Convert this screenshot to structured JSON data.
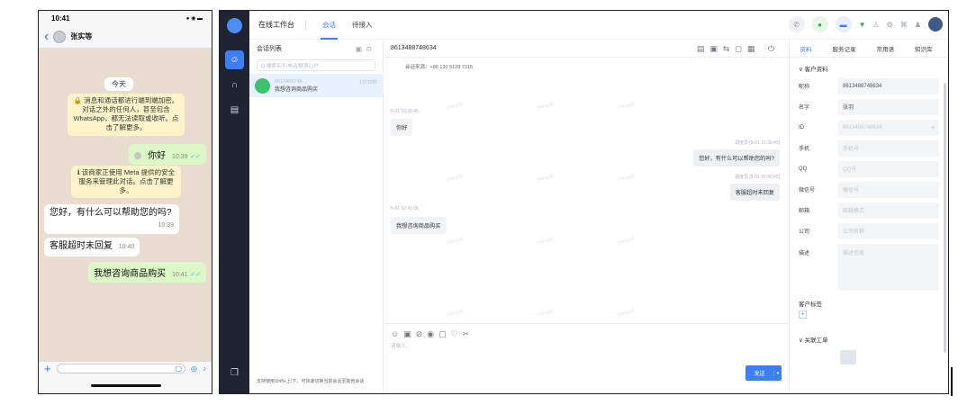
{
  "phone": {
    "status_time": "10:41",
    "status_icons": "● ◉ ▬",
    "back": "‹",
    "contact_name": "张实等",
    "day": "今天",
    "encryption_notice": "🔒 消息和通话都进行端到端加密。对话之外的任何人，甚至包含 WhatsApp，都无法读取或收听。点击了解更多。",
    "meta_notice": "ℹ 该商家正使用 Meta 提供的安全服务来管理此对话。点击了解更多。",
    "messages": [
      {
        "text": "你好",
        "time": "10:39"
      },
      {
        "text": "您好，有什么可以帮助您的吗?",
        "time": "10:39"
      },
      {
        "text": "客服超时未回复",
        "time": "10:40"
      },
      {
        "text": "我想咨询商品购买",
        "time": "10:41"
      }
    ]
  },
  "app": {
    "title": "在线工作台",
    "tabs": [
      "会话",
      "待接入"
    ],
    "list_title": "会话列表",
    "search_placeholder": "Q 搜索名字/电话/联系心户",
    "conversation": {
      "phone": "8613488748...",
      "message": "我想咨询商品购买",
      "time": "1分30秒"
    },
    "list_footer": "支持使用Shift+上/下、可快速切换当前会话至其他会话",
    "chat_title": "8613488748634",
    "chat_source": "会话来源：+86 130 5128 7315",
    "chat": {
      "ts1": "6-01 10:39:45",
      "msg1": "你好",
      "ts2": "调度员 [6-01 10:39:45]",
      "msg2": "您好，有什么可以帮助您的吗?",
      "ts3": "调度员 [6-01 10:40:45]",
      "msg3": "客服超时未回复",
      "ts4": "6-01 10:41:06",
      "msg4": "我想咨询商品购买"
    },
    "composer_placeholder": "请输入...",
    "send_label": "发送",
    "panel_tabs": [
      "资料",
      "服务记录",
      "常用语",
      "知识库"
    ],
    "customer_section": "∨ 客户资料",
    "fields": [
      {
        "label": "昵称",
        "value": "8613488748634",
        "placeholder": false
      },
      {
        "label": "名字",
        "value": "张羽",
        "placeholder": false
      },
      {
        "label": "ID",
        "value": "8613488748634",
        "placeholder": true
      },
      {
        "label": "手机",
        "value": "手机号",
        "placeholder": true
      },
      {
        "label": "QQ",
        "value": "QQ号",
        "placeholder": true
      },
      {
        "label": "微信号",
        "value": "微信号",
        "placeholder": true
      },
      {
        "label": "邮箱",
        "value": "邮箱格式",
        "placeholder": true
      },
      {
        "label": "公司",
        "value": "公司名称",
        "placeholder": true
      }
    ],
    "desc_label": "描述",
    "desc_placeholder": "描述信息",
    "tags_label": "客户标签",
    "tickets_section": "∨ 关联工单",
    "watermark": "zhang羽"
  },
  "colors": {
    "accent": "#3d7ff0",
    "rail": "#1f2430",
    "whatsapp_out": "#dcf8c6",
    "chat_bg": "#e9ddd2"
  }
}
